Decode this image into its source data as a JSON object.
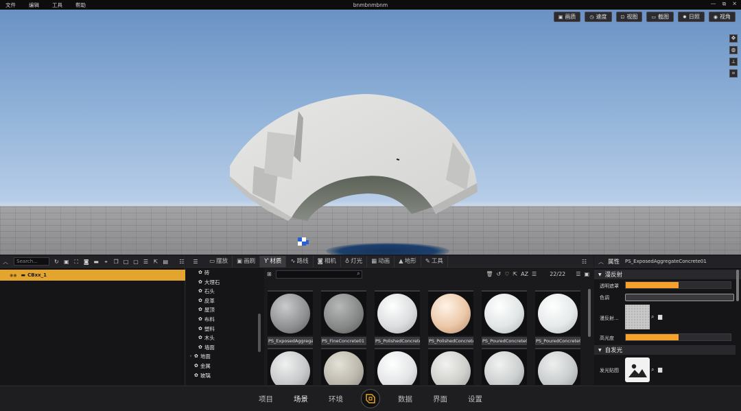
{
  "window": {
    "title": "bnmbnmbnm",
    "menu": [
      "文件",
      "编辑",
      "工具",
      "帮助"
    ],
    "controls": [
      "—",
      "⧉",
      "✕"
    ]
  },
  "viewport": {
    "toolbar": [
      {
        "icon": "▣",
        "label": "画质"
      },
      {
        "icon": "◷",
        "label": "速度"
      },
      {
        "icon": "⊡",
        "label": "视图"
      },
      {
        "icon": "▭",
        "label": "截图"
      },
      {
        "icon": "✹",
        "label": "日照"
      },
      {
        "icon": "◉",
        "label": "视角"
      }
    ],
    "side_tools": [
      "✥",
      "◍",
      "⟂",
      "⌗"
    ]
  },
  "outliner": {
    "search_placeholder": "Search...",
    "selected_item": "CBxx_1"
  },
  "library": {
    "tabs": [
      {
        "icon": "▭",
        "label": "摆放"
      },
      {
        "icon": "▣",
        "label": "画刷"
      },
      {
        "icon": "Ƴ",
        "label": "材质"
      },
      {
        "icon": "∿",
        "label": "路线"
      },
      {
        "icon": "◙",
        "label": "相机"
      },
      {
        "icon": "♁",
        "label": "灯光"
      },
      {
        "icon": "▦",
        "label": "动画"
      },
      {
        "icon": "▲",
        "label": "地形"
      },
      {
        "icon": "✎",
        "label": "工具"
      }
    ],
    "active_tab": "材质",
    "categories_sub": [
      "砖",
      "大理石",
      "石头",
      "皮革",
      "屋顶",
      "布料",
      "塑料",
      "木头",
      "墙面"
    ],
    "categories_top": [
      "地面",
      "金属",
      "玻璃"
    ],
    "count": "22/22",
    "materials": [
      "PS_ExposedAggregateConcrete01",
      "PS_FineConcrete01",
      "PS_PolishedConcrete01",
      "PS_PolishedConcrete02",
      "PS_PouredConcrete01",
      "PS_PouredConcrete02"
    ]
  },
  "properties": {
    "title": "属性",
    "material_name": "PS_ExposedAggregateConcrete01",
    "section_diffuse": "漫反射",
    "opacity_label": "透明遮罩",
    "opacity_value": 0.5,
    "tint_label": "色调",
    "diffuse_map_label": "漫反射...",
    "specular_label": "高光度",
    "specular_value": 0.5,
    "section_emissive": "自发光",
    "emissive_map_label": "发光贴图"
  },
  "bottom_nav": {
    "items": [
      "项目",
      "场景",
      "环境",
      "数据",
      "界面",
      "设置"
    ],
    "active": "场景"
  },
  "colors": {
    "accent": "#e3a52e",
    "slider": "#f5a12a",
    "panel_bg": "#151517"
  }
}
